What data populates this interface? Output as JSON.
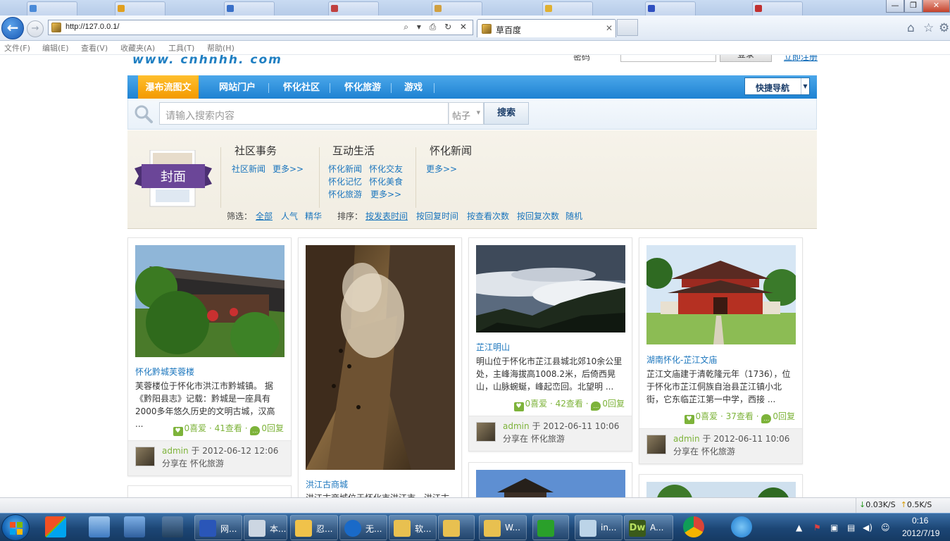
{
  "browser": {
    "bg_tabs": [
      "",
      "",
      "",
      "",
      "",
      "",
      "",
      "",
      ""
    ],
    "address": "http://127.0.0.1/",
    "address_icons": "⌕ ▾ ⎙ ↻ ✕",
    "tab_title": "草百度",
    "tab_close": "✕",
    "menu": [
      "文件(F)",
      "编辑(E)",
      "查看(V)",
      "收藏夹(A)",
      "工具(T)",
      "帮助(H)"
    ],
    "window_controls": {
      "min": "—",
      "max": "❐",
      "close": "✕"
    }
  },
  "site": {
    "logo": "www. cnhnhh. com",
    "password_label": "密码",
    "login_button": "登录",
    "register_link": "立即注册"
  },
  "nav": {
    "items": [
      "瀑布流图文",
      "网站门户",
      "怀化社区",
      "怀化旅游",
      "游戏"
    ],
    "quick_nav": "快捷导航"
  },
  "search": {
    "placeholder": "请输入搜索内容",
    "type": "帖子",
    "button": "搜索"
  },
  "cover": {
    "label": "封面"
  },
  "categories": [
    {
      "title": "社区事务",
      "links": [
        "社区新闻",
        "更多>>"
      ]
    },
    {
      "title": "互动生活",
      "links": [
        "怀化新闻",
        "怀化交友",
        "怀化记忆",
        "怀化美食",
        "怀化旅游",
        "更多>>"
      ]
    },
    {
      "title": "怀化新闻",
      "links": [
        "更多>>"
      ]
    }
  ],
  "filter": {
    "label": "筛选：",
    "options": [
      "全部",
      "人气",
      "精华"
    ],
    "sort_label": "排序：",
    "sort_options": [
      "按发表时间",
      "按回复时间",
      "按查看次数",
      "按回复次数",
      "随机"
    ]
  },
  "cards": [
    {
      "title": "怀化黔城芙蓉楼",
      "desc": "芙蓉楼位于怀化市洪江市黔城镇。 据《黔阳县志》记载：黔城是一座具有2000多年悠久历史的文明古城，汉高 ...",
      "likes": "0喜爱",
      "views": "41查看",
      "replies": "0回复",
      "author": "admin",
      "meta": "于 2012-06-12 12:06 分享在 怀化旅游"
    },
    {
      "title": "洪江古商城",
      "desc": "洪江古商城位于怀化市洪江市，洪江古"
    },
    {
      "title": "芷江明山",
      "desc": "明山位于怀化市芷江县城北郊10余公里处，主峰海拔高1008.2米，后倚西晃山，山脉蜿蜒，峰起峦回。北望明 ...",
      "likes": "0喜爱",
      "views": "42查看",
      "replies": "0回复",
      "author": "admin",
      "meta": "于 2012-06-11 10:06 分享在 怀化旅游"
    },
    {
      "title": "湖南怀化-芷江文庙",
      "desc": "芷江文庙建于清乾隆元年（1736），位于怀化市芷江侗族自治县芷江镇小北街，它东临芷江第一中学，西接 ...",
      "likes": "0喜爱",
      "views": "37查看",
      "replies": "0回复",
      "author": "admin",
      "meta": "于 2012-06-11 10:06 分享在 怀化旅游"
    }
  ],
  "statusbar": {
    "down": "0.03K/S",
    "up": "0.5K/S"
  },
  "taskbar": {
    "windows": [
      "网...",
      "本...",
      "忍...",
      "无...",
      "软...",
      "",
      "W...",
      "",
      "in...",
      "A..."
    ],
    "time": "0:16",
    "date": "2012/7/19"
  },
  "colors": {
    "nav_blue": "#2a8ee0",
    "nav_active": "#f8a90f",
    "link_blue": "#1a75bd",
    "stat_green": "#7db33a"
  }
}
